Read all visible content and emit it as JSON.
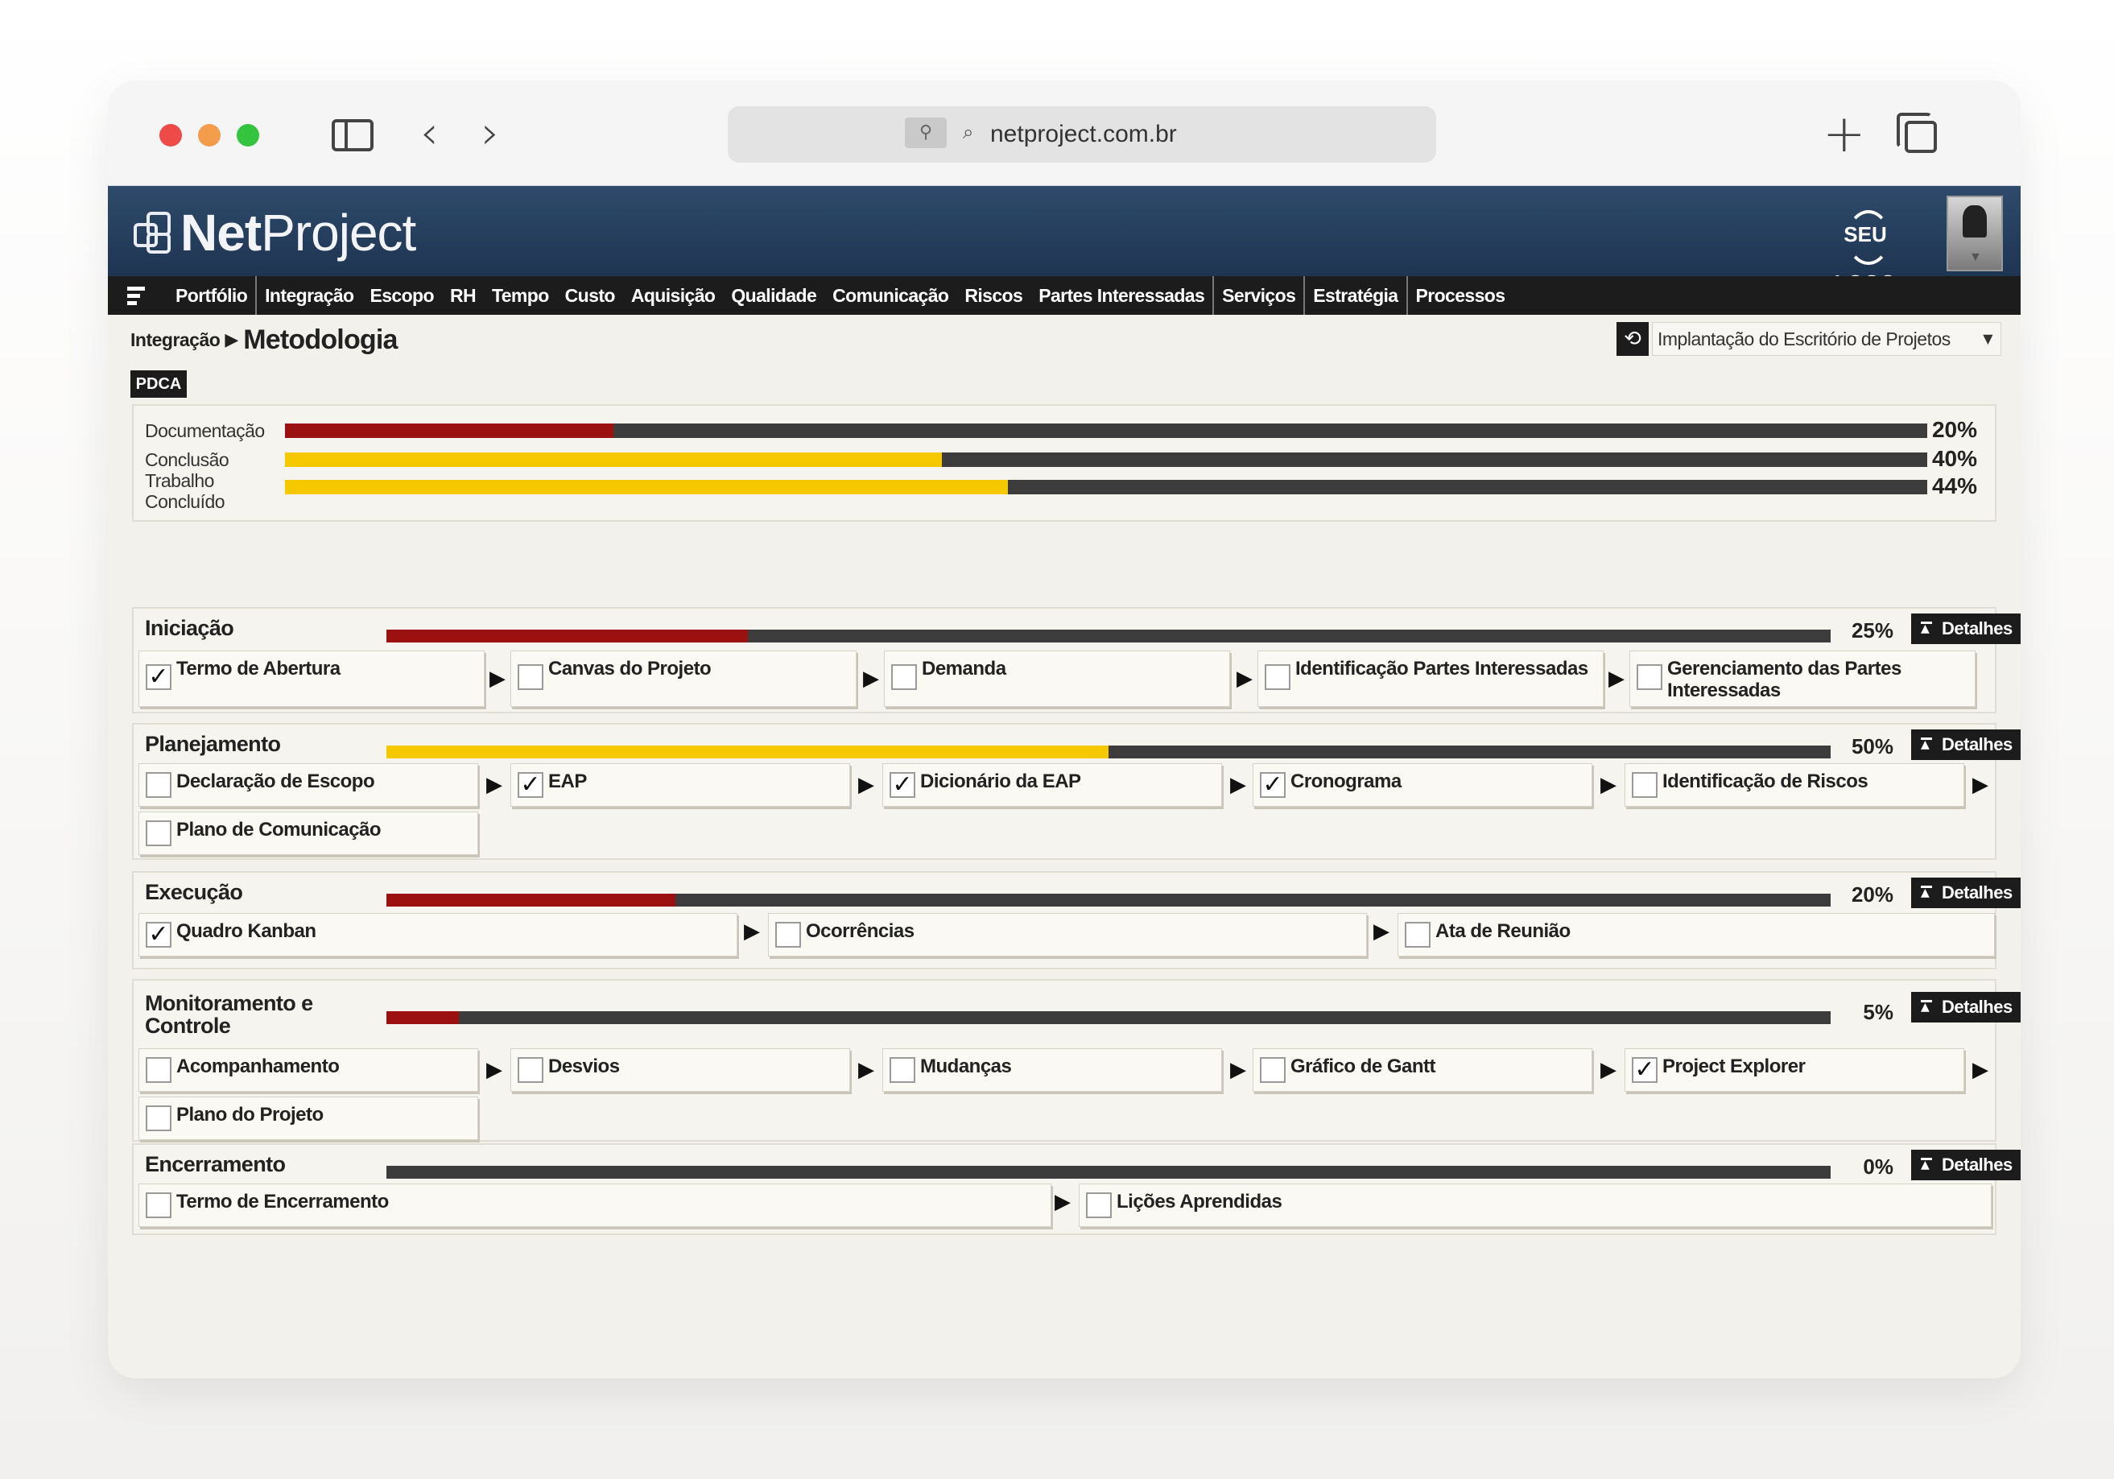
{
  "browser": {
    "url": "netproject.com.br"
  },
  "app": {
    "logo_bold": "Net",
    "logo_light": "Project",
    "brand_logo": "SEU LOGO"
  },
  "menu": [
    "Portfólio",
    "Integração",
    "Escopo",
    "RH",
    "Tempo",
    "Custo",
    "Aquisição",
    "Qualidade",
    "Comunicação",
    "Riscos",
    "Partes Interessadas",
    "Serviços",
    "Estratégia",
    "Processos"
  ],
  "breadcrumb": {
    "parent": "Integração",
    "current": "Metodologia"
  },
  "project_select": {
    "value": "Implantação do Escritório de Projetos"
  },
  "pdca_label": "PDCA",
  "summary": [
    {
      "label": "Documentação",
      "pct_text": "20%",
      "value": 0.2,
      "color": "#9b1111"
    },
    {
      "label": "Conclusão",
      "pct_text": "40%",
      "value": 0.4,
      "color": "#f5c800"
    },
    {
      "label": "Trabalho Concluído",
      "pct_text": "44%",
      "value": 0.44,
      "color": "#f5c800"
    }
  ],
  "details_label": "Detalhes",
  "phases": [
    {
      "title": "Iniciação",
      "pct_text": "25%",
      "value": 0.25,
      "color": "#9b1111",
      "steps": [
        {
          "label": "Termo de Abertura",
          "checked": true
        },
        {
          "label": "Canvas do Projeto",
          "checked": false
        },
        {
          "label": "Demanda",
          "checked": false
        },
        {
          "label": "Identificação Partes Interessadas",
          "checked": false
        },
        {
          "label": "Gerenciamento das Partes Interessadas",
          "checked": false
        }
      ]
    },
    {
      "title": "Planejamento",
      "pct_text": "50%",
      "value": 0.5,
      "color": "#f5c800",
      "steps": [
        {
          "label": "Declaração de Escopo",
          "checked": false
        },
        {
          "label": "EAP",
          "checked": true
        },
        {
          "label": "Dicionário da EAP",
          "checked": true
        },
        {
          "label": "Cronograma",
          "checked": true
        },
        {
          "label": "Identificação de Riscos",
          "checked": false
        },
        {
          "label": "Plano de Comunicação",
          "checked": false
        }
      ]
    },
    {
      "title": "Execução",
      "pct_text": "20%",
      "value": 0.2,
      "color": "#9b1111",
      "steps": [
        {
          "label": "Quadro Kanban",
          "checked": true
        },
        {
          "label": "Ocorrências",
          "checked": false
        },
        {
          "label": "Ata de Reunião",
          "checked": false
        }
      ]
    },
    {
      "title": "Monitoramento e Controle",
      "pct_text": "5%",
      "value": 0.05,
      "color": "#9b1111",
      "steps": [
        {
          "label": "Acompanhamento",
          "checked": false
        },
        {
          "label": "Desvios",
          "checked": false
        },
        {
          "label": "Mudanças",
          "checked": false
        },
        {
          "label": "Gráfico de Gantt",
          "checked": false
        },
        {
          "label": "Project Explorer",
          "checked": true
        },
        {
          "label": "Plano do Projeto",
          "checked": false
        }
      ]
    },
    {
      "title": "Encerramento",
      "pct_text": "0%",
      "value": 0.0,
      "color": "#9b1111",
      "steps": [
        {
          "label": "Termo de Encerramento",
          "checked": false
        },
        {
          "label": "Lições Aprendidas",
          "checked": false
        }
      ]
    }
  ],
  "icons": {
    "check": "✓",
    "flow_arrow": "▶",
    "breadcrumb_arrow": "▶",
    "select_caret": "▼"
  }
}
